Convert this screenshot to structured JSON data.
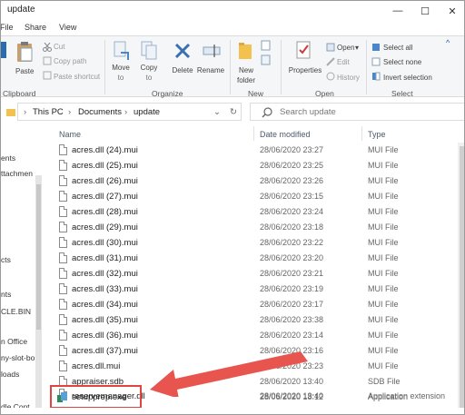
{
  "window": {
    "title": "update",
    "controls": {
      "minimize": "—",
      "maximize": "☐",
      "close": "✕"
    }
  },
  "tabs": [
    "File",
    "Share",
    "View"
  ],
  "ribbon": {
    "clipboard": {
      "label": "Clipboard",
      "paste": "Paste",
      "cut": "Cut",
      "copy_path": "Copy path",
      "paste_shortcut": "Paste shortcut"
    },
    "organize": {
      "label": "Organize",
      "move_to": "Move",
      "move_to_2": "to",
      "copy_to": "Copy",
      "copy_to_2": "to",
      "delete": "Delete",
      "rename": "Rename"
    },
    "new": {
      "label": "New",
      "new_folder": "New",
      "new_folder_2": "folder"
    },
    "open": {
      "label": "Open",
      "properties": "Properties",
      "open": "Open",
      "edit": "Edit",
      "history": "History"
    },
    "select": {
      "label": "Select",
      "select_all": "Select all",
      "select_none": "Select none",
      "invert_selection": "Invert selection"
    }
  },
  "address": {
    "crumbs": [
      "This PC",
      "Documents",
      "update"
    ],
    "search_placeholder": "Search update"
  },
  "nav": {
    "items": [
      "ents",
      "ttachmen",
      "cts",
      "",
      "nts",
      "CLE.BIN",
      "n Office",
      "ny-slot-bo",
      "loads",
      "dle Cont"
    ]
  },
  "columns": {
    "name": "Name",
    "date": "Date modified",
    "type": "Type"
  },
  "files": [
    {
      "name": "acres.dll (24).mui",
      "date": "28/06/2020 23:27",
      "type": "MUI File"
    },
    {
      "name": "acres.dll (25).mui",
      "date": "28/06/2020 23:25",
      "type": "MUI File"
    },
    {
      "name": "acres.dll (26).mui",
      "date": "28/06/2020 23:26",
      "type": "MUI File"
    },
    {
      "name": "acres.dll (27).mui",
      "date": "28/06/2020 23:15",
      "type": "MUI File"
    },
    {
      "name": "acres.dll (28).mui",
      "date": "28/06/2020 23:24",
      "type": "MUI File"
    },
    {
      "name": "acres.dll (29).mui",
      "date": "28/06/2020 23:18",
      "type": "MUI File"
    },
    {
      "name": "acres.dll (30).mui",
      "date": "28/06/2020 23:22",
      "type": "MUI File"
    },
    {
      "name": "acres.dll (31).mui",
      "date": "28/06/2020 23:20",
      "type": "MUI File"
    },
    {
      "name": "acres.dll (32).mui",
      "date": "28/06/2020 23:21",
      "type": "MUI File"
    },
    {
      "name": "acres.dll (33).mui",
      "date": "28/06/2020 23:19",
      "type": "MUI File"
    },
    {
      "name": "acres.dll (34).mui",
      "date": "28/06/2020 23:17",
      "type": "MUI File"
    },
    {
      "name": "acres.dll (35).mui",
      "date": "28/06/2020 23:38",
      "type": "MUI File"
    },
    {
      "name": "acres.dll (36).mui",
      "date": "28/06/2020 23:14",
      "type": "MUI File"
    },
    {
      "name": "acres.dll (37).mui",
      "date": "28/06/2020 23:16",
      "type": "MUI File"
    },
    {
      "name": "acres.dll.mui",
      "date": "28/06/2020 23:23",
      "type": "MUI File"
    },
    {
      "name": "appraiser.sdb",
      "date": "28/06/2020 13:40",
      "type": "SDB File"
    },
    {
      "name": "reservemanager.dll",
      "date": "28/06/2020 13:40",
      "type": "Application extension"
    },
    {
      "name": "setupprep.exe",
      "date": "28/06/2020 18:12",
      "type": "Application"
    }
  ],
  "colors": {
    "accent_blue": "#1a5fa8",
    "highlight_red": "#e0453f",
    "arrow_red": "#e8544e",
    "folder_yellow": "#f2c14e"
  }
}
